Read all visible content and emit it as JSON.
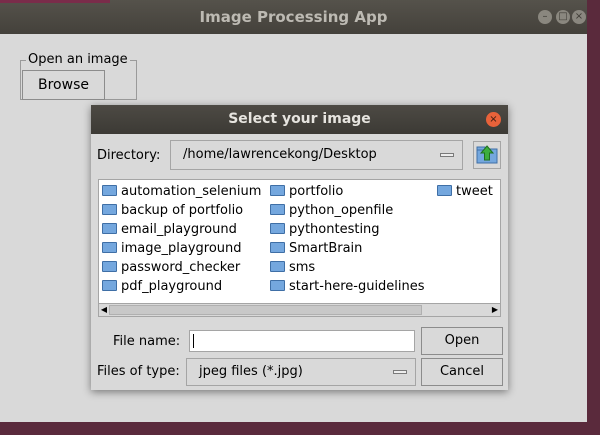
{
  "window": {
    "title": "Image Processing App"
  },
  "main": {
    "group_label": "Open an image",
    "browse_label": "Browse"
  },
  "dialog": {
    "title": "Select your image",
    "directory_label": "Directory:",
    "directory_value": "/home/lawrencekong/Desktop",
    "files": {
      "col1": [
        "automation_selenium",
        "backup of portfolio",
        "email_playground",
        "image_playground",
        "password_checker",
        "pdf_playground"
      ],
      "col2": [
        "portfolio",
        "python_openfile",
        "pythontesting",
        "SmartBrain",
        "sms",
        "start-here-guidelines"
      ],
      "col3": [
        "tweet"
      ]
    },
    "filename_label": "File name:",
    "filename_value": "",
    "filetype_label": "Files of type:",
    "filetype_value": "jpeg files (*.jpg)",
    "open_label": "Open",
    "cancel_label": "Cancel"
  },
  "colors": {
    "folder": "#74a7de",
    "close_button": "#e8623a",
    "titlebar": "#44413b"
  },
  "icons": {
    "close": "close-icon",
    "folder": "folder-icon",
    "up": "up-folder-icon"
  }
}
